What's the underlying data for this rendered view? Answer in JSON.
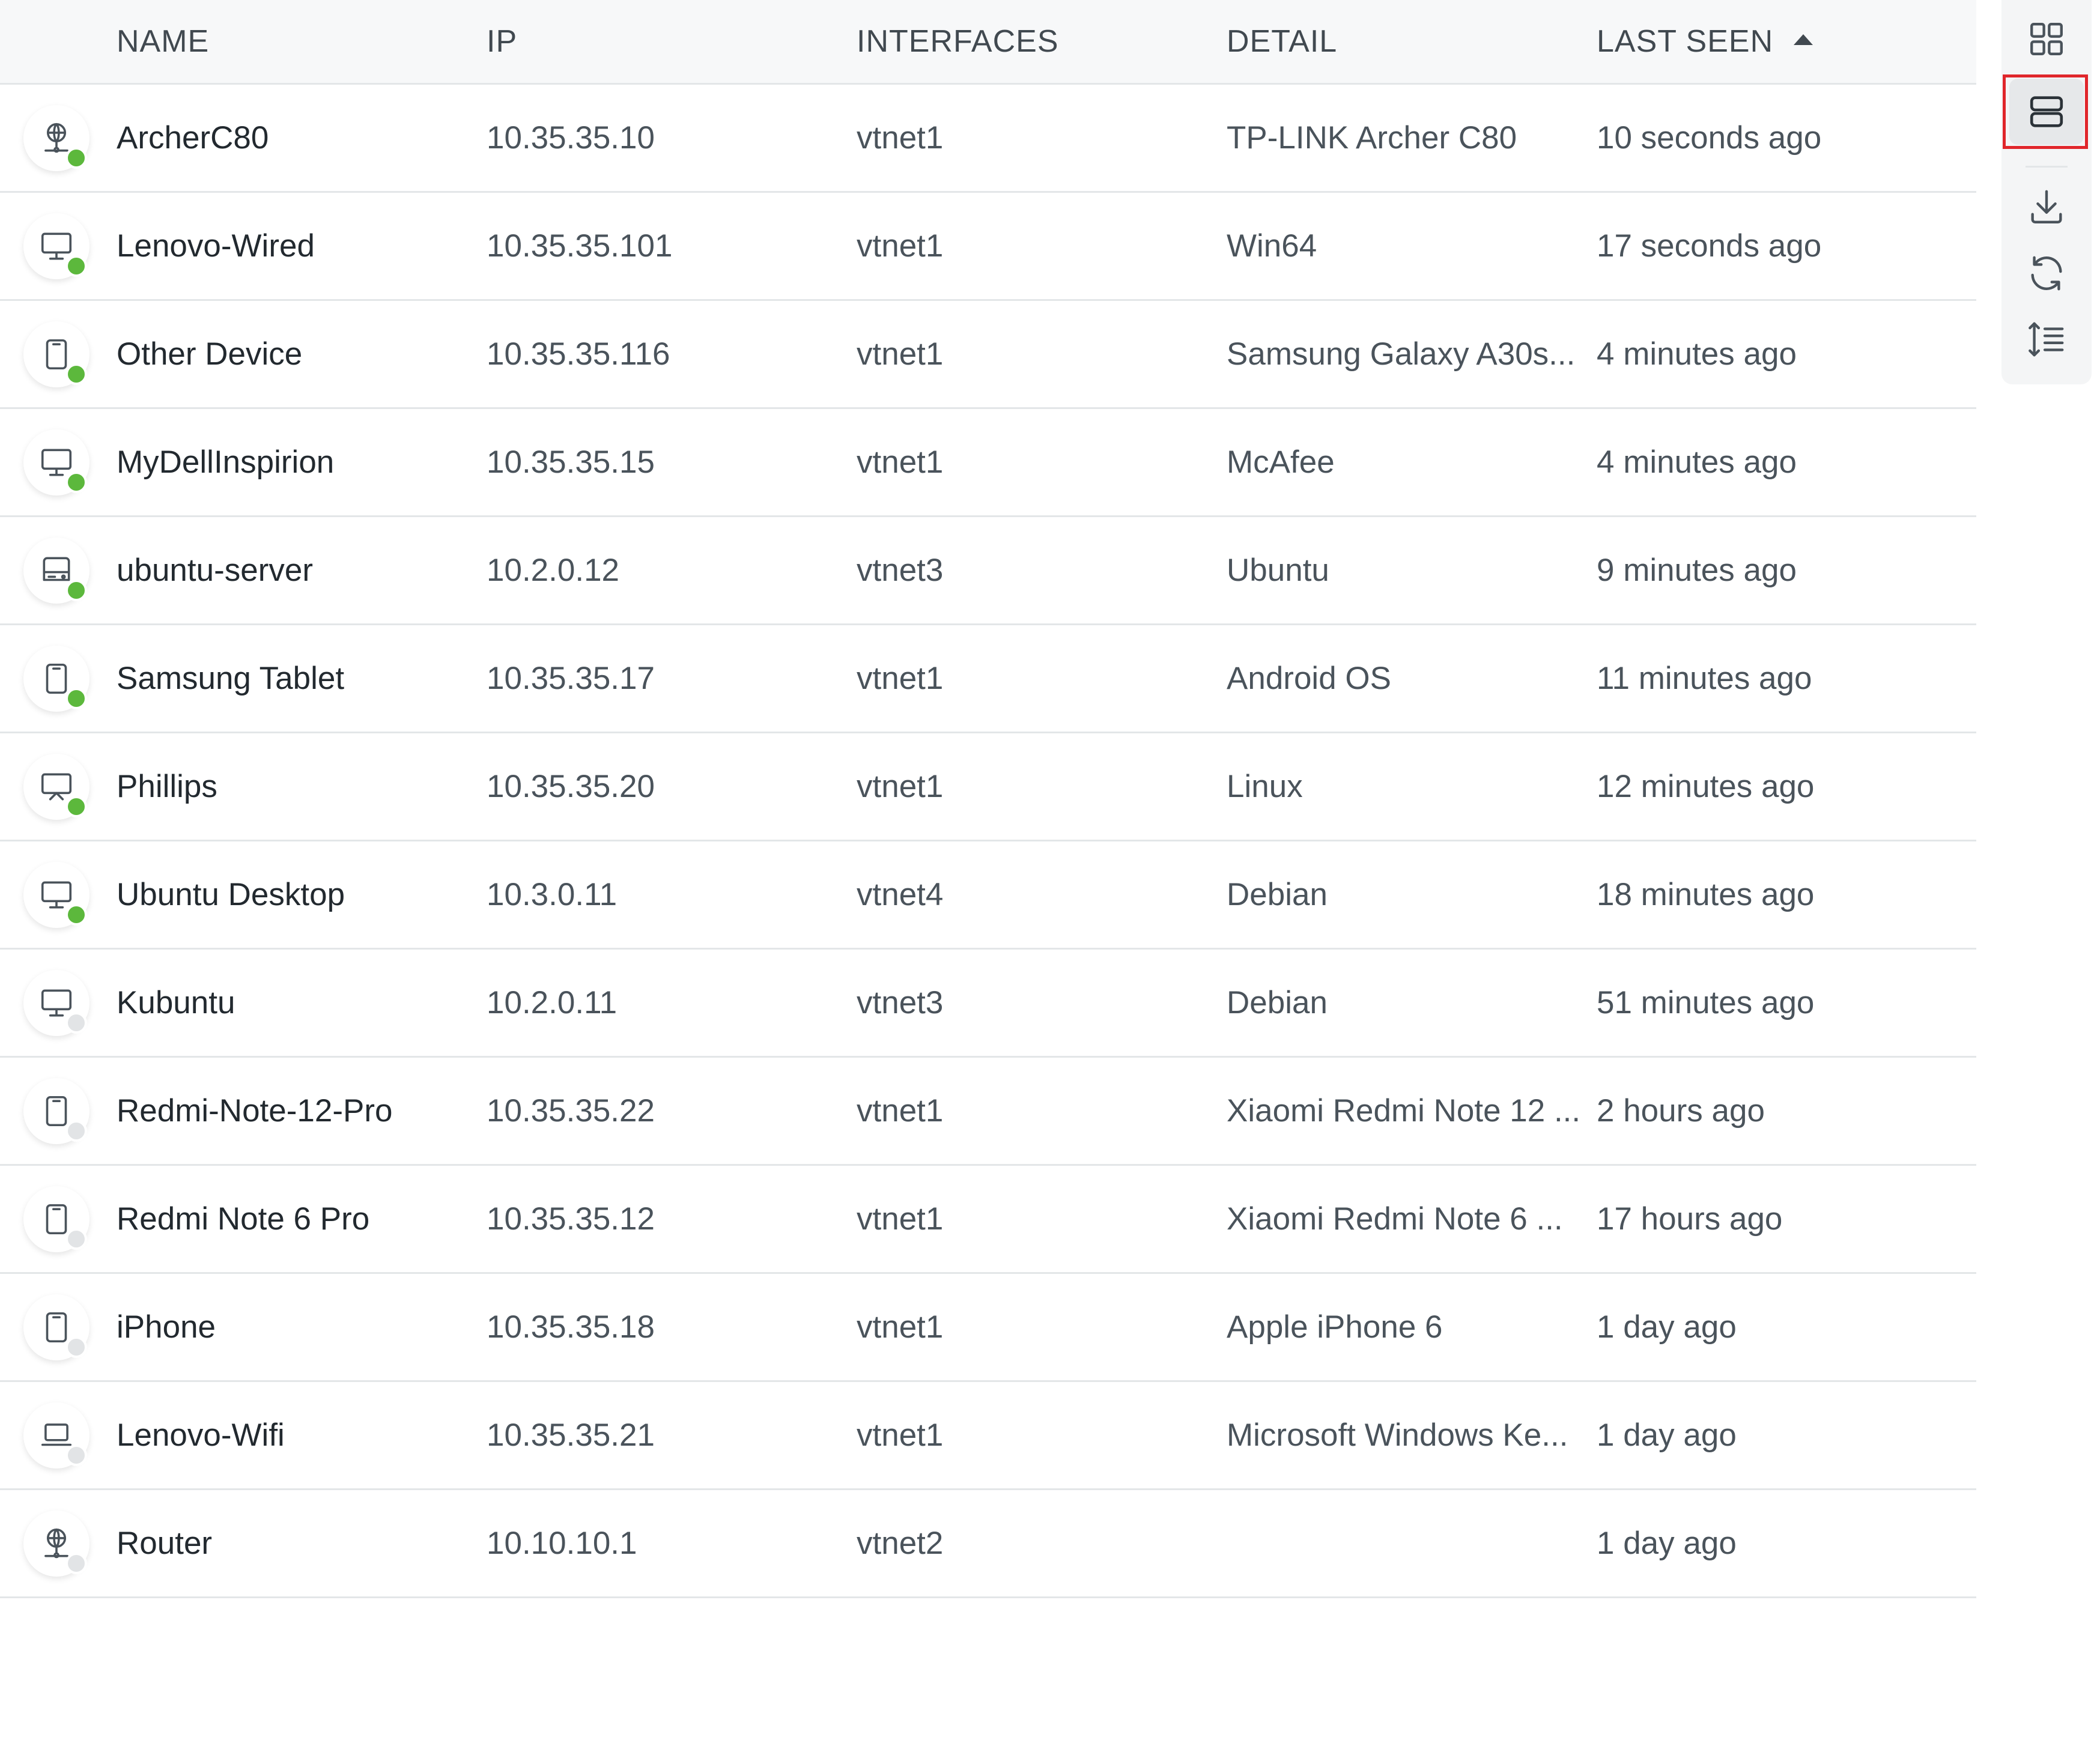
{
  "colors": {
    "online": "#5cb83c",
    "offline": "#e2e4e6",
    "icon_stroke": "#4a535b",
    "highlight": "#e0262b"
  },
  "table": {
    "headers": {
      "name": "NAME",
      "ip": "IP",
      "interfaces": "INTERFACES",
      "detail": "DETAIL",
      "last_seen": "LAST SEEN"
    },
    "sort": {
      "column": "last_seen",
      "direction": "asc"
    },
    "rows": [
      {
        "icon": "router-icon",
        "status": "online",
        "name": "ArcherC80",
        "ip": "10.35.35.10",
        "interfaces": "vtnet1",
        "detail": "TP-LINK Archer C80",
        "last_seen": "10 seconds ago"
      },
      {
        "icon": "desktop-icon",
        "status": "online",
        "name": "Lenovo-Wired",
        "ip": "10.35.35.101",
        "interfaces": "vtnet1",
        "detail": "Win64",
        "last_seen": "17 seconds ago"
      },
      {
        "icon": "phone-icon",
        "status": "online",
        "name": "Other Device",
        "ip": "10.35.35.116",
        "interfaces": "vtnet1",
        "detail": "Samsung Galaxy A30s...",
        "last_seen": "4 minutes ago"
      },
      {
        "icon": "desktop-icon",
        "status": "online",
        "name": "MyDellInspirion",
        "ip": "10.35.35.15",
        "interfaces": "vtnet1",
        "detail": "McAfee",
        "last_seen": "4 minutes ago"
      },
      {
        "icon": "server-icon",
        "status": "online",
        "name": "ubuntu-server",
        "ip": "10.2.0.12",
        "interfaces": "vtnet3",
        "detail": "Ubuntu",
        "last_seen": "9 minutes ago"
      },
      {
        "icon": "phone-icon",
        "status": "online",
        "name": "Samsung Tablet",
        "ip": "10.35.35.17",
        "interfaces": "vtnet1",
        "detail": "Android OS",
        "last_seen": "11 minutes ago"
      },
      {
        "icon": "tv-icon",
        "status": "online",
        "name": "Phillips",
        "ip": "10.35.35.20",
        "interfaces": "vtnet1",
        "detail": "Linux",
        "last_seen": "12 minutes ago"
      },
      {
        "icon": "desktop-icon",
        "status": "online",
        "name": "Ubuntu Desktop",
        "ip": "10.3.0.11",
        "interfaces": "vtnet4",
        "detail": "Debian",
        "last_seen": "18 minutes ago"
      },
      {
        "icon": "desktop-icon",
        "status": "offline",
        "name": "Kubuntu",
        "ip": "10.2.0.11",
        "interfaces": "vtnet3",
        "detail": "Debian",
        "last_seen": "51 minutes ago"
      },
      {
        "icon": "phone-icon",
        "status": "offline",
        "name": "Redmi-Note-12-Pro",
        "ip": "10.35.35.22",
        "interfaces": "vtnet1",
        "detail": "Xiaomi Redmi Note 12 ...",
        "last_seen": "2 hours ago"
      },
      {
        "icon": "phone-icon",
        "status": "offline",
        "name": "Redmi Note 6 Pro",
        "ip": "10.35.35.12",
        "interfaces": "vtnet1",
        "detail": "Xiaomi Redmi Note 6 ...",
        "last_seen": "17 hours ago"
      },
      {
        "icon": "phone-icon",
        "status": "offline",
        "name": "iPhone",
        "ip": "10.35.35.18",
        "interfaces": "vtnet1",
        "detail": "Apple iPhone 6",
        "last_seen": "1 day ago"
      },
      {
        "icon": "laptop-icon",
        "status": "offline",
        "name": "Lenovo-Wifi",
        "ip": "10.35.35.21",
        "interfaces": "vtnet1",
        "detail": "Microsoft Windows Ke...",
        "last_seen": "1 day ago"
      },
      {
        "icon": "router-icon",
        "status": "offline",
        "name": "Router",
        "ip": "10.10.10.1",
        "interfaces": "vtnet2",
        "detail": "",
        "last_seen": "1 day ago"
      }
    ]
  },
  "toolbar": {
    "buttons": [
      {
        "id": "grid-view",
        "icon": "grid-view-icon",
        "active": false
      },
      {
        "id": "list-view",
        "icon": "list-view-icon",
        "active": true,
        "highlighted": true
      },
      {
        "id": "download",
        "icon": "download-icon",
        "active": false
      },
      {
        "id": "refresh",
        "icon": "refresh-icon",
        "active": false
      },
      {
        "id": "row-density",
        "icon": "row-density-icon",
        "active": false
      }
    ]
  }
}
